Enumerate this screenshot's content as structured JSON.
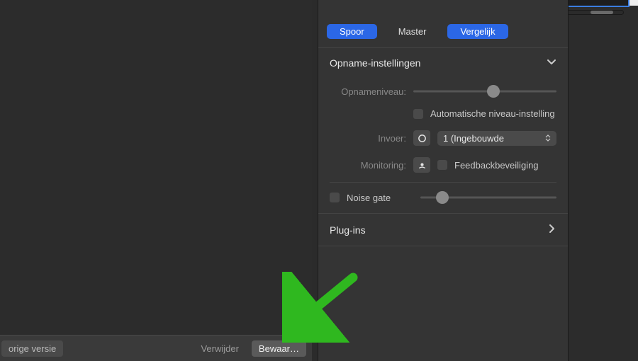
{
  "colors": {
    "accent": "#2b67e6",
    "annotation_arrow": "#2fb81f"
  },
  "tabs": {
    "spoor": "Spoor",
    "master": "Master",
    "vergelijk": "Vergelijk",
    "active": "spoor"
  },
  "sections": {
    "recording": {
      "title": "Opname-instellingen",
      "level_label": "Opnameniveau:",
      "level_value": 0.56,
      "auto_level_label": "Automatische niveau-instelling",
      "auto_level_checked": false,
      "input_label": "Invoer:",
      "input_selected": "1 (Ingebouwde",
      "monitoring_label": "Monitoring:",
      "feedback_label": "Feedbackbeveiliging",
      "feedback_checked": false,
      "noise_gate_label": "Noise gate",
      "noise_gate_checked": false,
      "noise_gate_value": 0.16
    },
    "plugins": {
      "title": "Plug-ins"
    }
  },
  "footer": {
    "previous_version": "orige versie",
    "delete": "Verwijder",
    "save": "Bewaar…"
  },
  "icons": {
    "input": "input-circle-icon",
    "monitoring": "monitoring-speaker-icon"
  }
}
